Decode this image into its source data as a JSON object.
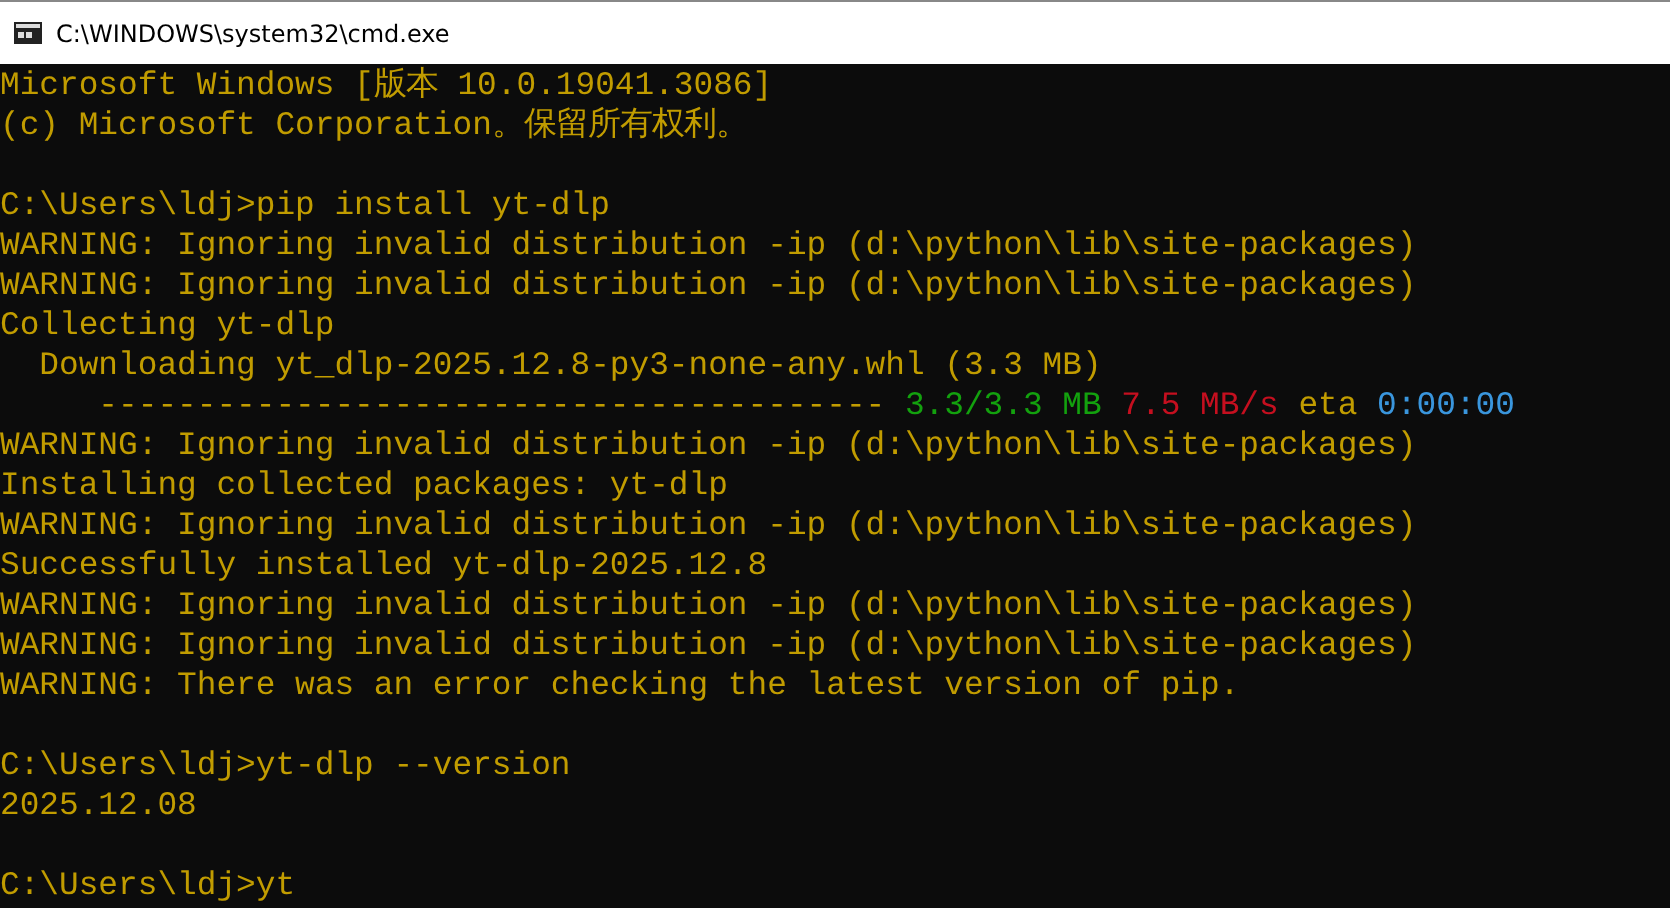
{
  "window": {
    "title": "C:\\WINDOWS\\system32\\cmd.exe"
  },
  "console": {
    "lines": [
      {
        "kind": "text",
        "segments": [
          {
            "text": "Microsoft Windows [版本 10.0.19041.3086]"
          }
        ]
      },
      {
        "kind": "text",
        "segments": [
          {
            "text": "(c) Microsoft Corporation。保留所有权利。"
          }
        ]
      },
      {
        "kind": "blank"
      },
      {
        "kind": "text",
        "segments": [
          {
            "text": "C:\\Users\\ldj>pip install yt-dlp"
          }
        ]
      },
      {
        "kind": "text",
        "segments": [
          {
            "text": "WARNING: Ignoring invalid distribution -ip (d:\\python\\lib\\site-packages)"
          }
        ]
      },
      {
        "kind": "text",
        "segments": [
          {
            "text": "WARNING: Ignoring invalid distribution -ip (d:\\python\\lib\\site-packages)"
          }
        ]
      },
      {
        "kind": "text",
        "segments": [
          {
            "text": "Collecting yt-dlp"
          }
        ]
      },
      {
        "kind": "text",
        "segments": [
          {
            "text": "  Downloading yt_dlp-2025.12.8-py3-none-any.whl (3.3 MB)"
          }
        ]
      },
      {
        "kind": "text",
        "segments": [
          {
            "text": "     ----------------------------------------"
          },
          {
            "text": " 3.3/3.3 MB",
            "color": "#13a10e"
          },
          {
            "text": " 7.5 MB/s",
            "color": "#c50f1f"
          },
          {
            "text": " eta"
          },
          {
            "text": " 0:00:00",
            "color": "#3a96dd"
          }
        ]
      },
      {
        "kind": "text",
        "segments": [
          {
            "text": "WARNING: Ignoring invalid distribution -ip (d:\\python\\lib\\site-packages)"
          }
        ]
      },
      {
        "kind": "text",
        "segments": [
          {
            "text": "Installing collected packages: yt-dlp"
          }
        ]
      },
      {
        "kind": "text",
        "segments": [
          {
            "text": "WARNING: Ignoring invalid distribution -ip (d:\\python\\lib\\site-packages)"
          }
        ]
      },
      {
        "kind": "text",
        "segments": [
          {
            "text": "Successfully installed yt-dlp-2025.12.8"
          }
        ]
      },
      {
        "kind": "text",
        "segments": [
          {
            "text": "WARNING: Ignoring invalid distribution -ip (d:\\python\\lib\\site-packages)"
          }
        ]
      },
      {
        "kind": "text",
        "segments": [
          {
            "text": "WARNING: Ignoring invalid distribution -ip (d:\\python\\lib\\site-packages)"
          }
        ]
      },
      {
        "kind": "text",
        "segments": [
          {
            "text": "WARNING: There was an error checking the latest version of pip."
          }
        ]
      },
      {
        "kind": "blank"
      },
      {
        "kind": "text",
        "segments": [
          {
            "text": "C:\\Users\\ldj>yt-dlp --version"
          }
        ]
      },
      {
        "kind": "text",
        "segments": [
          {
            "text": "2025.12.08"
          }
        ]
      },
      {
        "kind": "blank"
      },
      {
        "kind": "text",
        "segments": [
          {
            "text": "C:\\Users\\ldj>yt"
          }
        ]
      }
    ]
  }
}
